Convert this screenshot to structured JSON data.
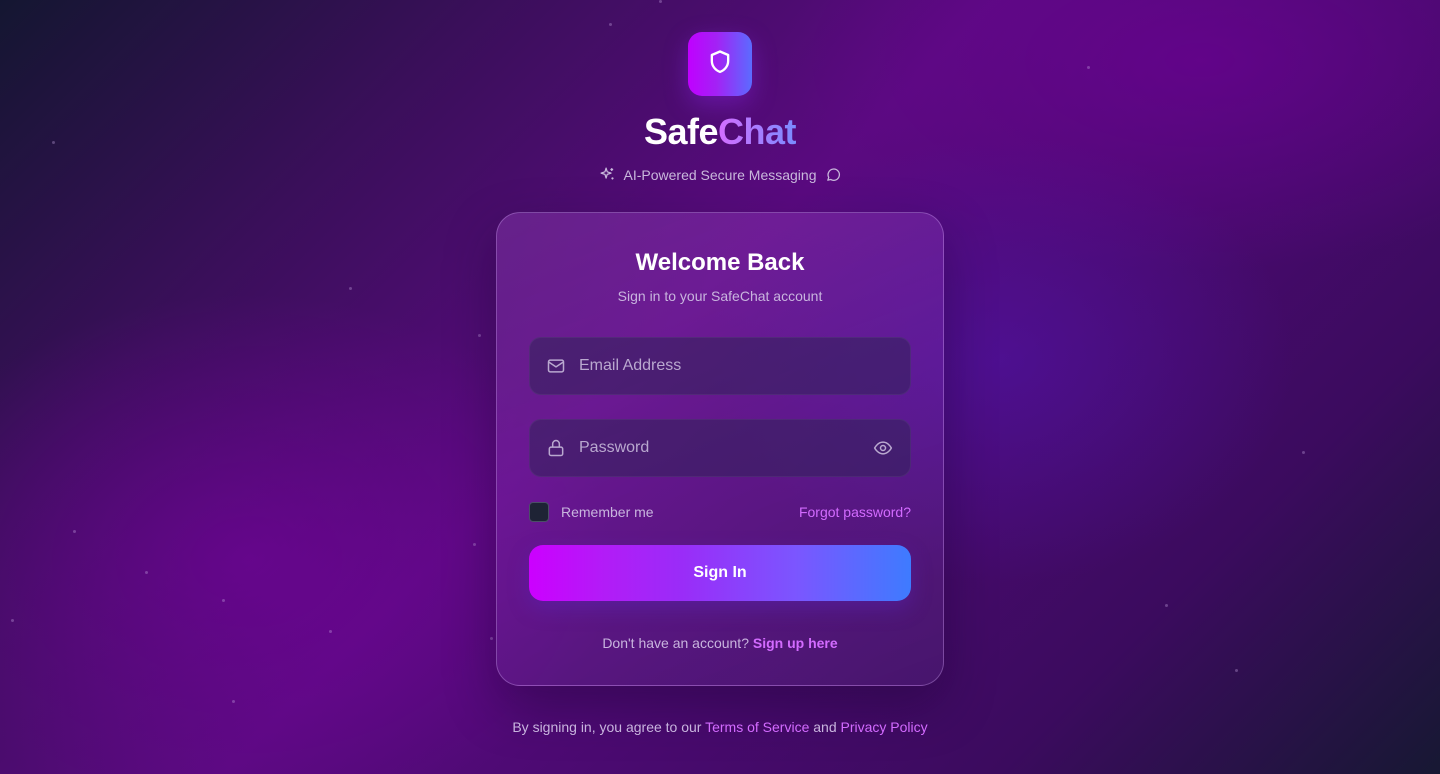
{
  "brand": {
    "name_part1": "Safe",
    "name_part2": "Chat",
    "tagline": "AI-Powered Secure Messaging",
    "logo_icon": "shield-icon",
    "tagline_left_icon": "sparkles-icon",
    "tagline_right_icon": "chat-bubble-icon"
  },
  "card": {
    "title": "Welcome Back",
    "subtitle": "Sign in to your SafeChat account"
  },
  "form": {
    "email": {
      "placeholder": "Email Address",
      "value": "",
      "icon": "mail-icon"
    },
    "password": {
      "placeholder": "Password",
      "value": "",
      "icon": "lock-icon",
      "toggle_icon": "eye-icon"
    },
    "remember_label": "Remember me",
    "remember_checked": false,
    "forgot_label": "Forgot password?",
    "submit_label": "Sign In"
  },
  "signup": {
    "prompt": "Don't have an account?",
    "link_label": "Sign up here"
  },
  "legal": {
    "prefix": "By signing in, you agree to our",
    "terms_label": "Terms of Service",
    "conjunction": "and",
    "privacy_label": "Privacy Policy"
  },
  "colors": {
    "accent_pink": "#d36bff",
    "gradient_start": "#cc00ff",
    "gradient_end": "#3e7bff",
    "background_deep": "#3a0f5a"
  }
}
